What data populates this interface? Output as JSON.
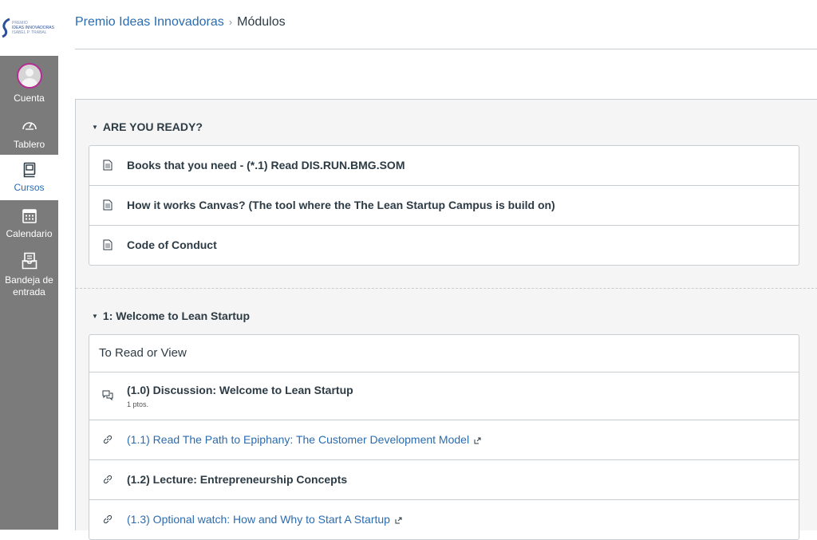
{
  "logo": {
    "line1": "PREMIO",
    "line2": "IDEAS INNOVADORAS",
    "line3": "ISABEL P. TRABAL"
  },
  "nav": {
    "account": "Cuenta",
    "dashboard": "Tablero",
    "courses": "Cursos",
    "calendar": "Calendario",
    "inbox": "Bandeja de entrada"
  },
  "breadcrumb": {
    "course": "Premio Ideas Innovadoras",
    "separator": "›",
    "current": "Módulos"
  },
  "modules": [
    {
      "title": "ARE YOU READY?",
      "items": [
        {
          "type": "page-icon",
          "title": "Books that you need - (*.1) Read DIS.RUN.BMG.SOM"
        },
        {
          "type": "page-icon",
          "title": "How it works Canvas? (The tool where the The Lean Startup Campus is build on)"
        },
        {
          "type": "page-icon",
          "title": "Code of Conduct"
        }
      ]
    },
    {
      "title": "1: Welcome to Lean Startup",
      "subheader": "To Read or View",
      "items": [
        {
          "type": "discussion-icon",
          "title": "(1.0) Discussion: Welcome to Lean Startup",
          "meta": "1 ptos."
        },
        {
          "type": "link-icon",
          "title": "(1.1) Read The Path to Epiphany: The Customer Development Model",
          "external": true
        },
        {
          "type": "link-icon",
          "title": "(1.2) Lecture: Entrepreneurship Concepts"
        },
        {
          "type": "link-icon",
          "title": "(1.3) Optional watch: How and Why to Start A Startup",
          "external": true
        }
      ]
    }
  ],
  "colors": {
    "sidebar": "#7b7b7b",
    "link": "#2b6cb0",
    "avatar_ring": "#b52c94"
  }
}
